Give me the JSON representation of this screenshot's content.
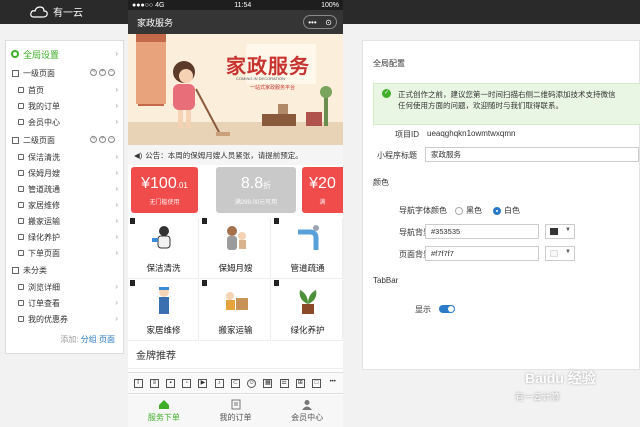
{
  "app": {
    "logo_text": "有一云"
  },
  "sidebar": {
    "global": "全局设置",
    "groups": [
      {
        "title": "一级页面",
        "items": [
          "首页",
          "我的订单",
          "会员中心"
        ]
      },
      {
        "title": "二级页面",
        "items": [
          "保洁清洗",
          "保姆月嫂",
          "管道疏通",
          "家居维修",
          "搬家运输",
          "绿化养护",
          "下单页面"
        ]
      },
      {
        "title": "未分类",
        "items": [
          "浏览详细",
          "订单查看",
          "我的优惠券"
        ]
      }
    ],
    "footer_prefix": "添加:",
    "footer_group": "分组",
    "footer_page": "页面"
  },
  "phone": {
    "status": {
      "carrier": "●●●○○ 4G",
      "time": "11:54",
      "battery": "100%"
    },
    "nav_title": "家政服务",
    "nav_cap": [
      "•••",
      "⊙"
    ],
    "banner": {
      "title": "家政服务",
      "subtitle": "COMING IN DECORATION",
      "tagline": "一站式家政服务平台"
    },
    "notice": "公告：本周的保姆月嫂人员紧张，请提前预定。",
    "coupons": [
      {
        "currency": "¥",
        "amount": "100",
        "decimal": ".01",
        "condition": "无门槛使用",
        "color": "#f04c4c"
      },
      {
        "currency": "",
        "amount": "8.8",
        "decimal": "折",
        "condition": "满299.00元可用",
        "color": "#c9c9c9"
      },
      {
        "currency": "¥",
        "amount": "20",
        "decimal": "",
        "condition": "满",
        "color": "#f04c4c"
      }
    ],
    "services": [
      "保洁清洗",
      "保姆月嫂",
      "管道疏通",
      "家居维修",
      "搬家运输",
      "绿化养护"
    ],
    "section_title": "金牌推荐",
    "tabs": [
      "服务下单",
      "我的订单",
      "会员中心"
    ]
  },
  "panel": {
    "title": "全局配置",
    "alert_line1": "正式创作之前，建议您第一时间扫描右侧二维码添加技术支持微信",
    "alert_line2": "任何使用方面的问题，欢迎随时与我们取得联系。",
    "project_id_label": "项目ID",
    "project_id_value": "ueaqghqkn1owmtwxqmn",
    "mini_title_label": "小程序标题",
    "mini_title_value": "家政服务",
    "color_section": "颜色",
    "nav_font_label": "导航字体颜色",
    "font_black": "黑色",
    "font_white": "白色",
    "nav_bg_label": "导航背景颜色",
    "nav_bg_value": "#353535",
    "page_bg_label": "页面背景颜色",
    "page_bg_value": "#f7f7f7",
    "tabbar_section": "TabBar",
    "show_label": "显示"
  },
  "colors": {
    "accent": "#3fae29",
    "nav": "#353535",
    "link": "#2a7ac7",
    "coupon_red": "#f04c4c"
  },
  "watermark": {
    "line1": "Baidu 经验",
    "line2": "有一云计算"
  }
}
